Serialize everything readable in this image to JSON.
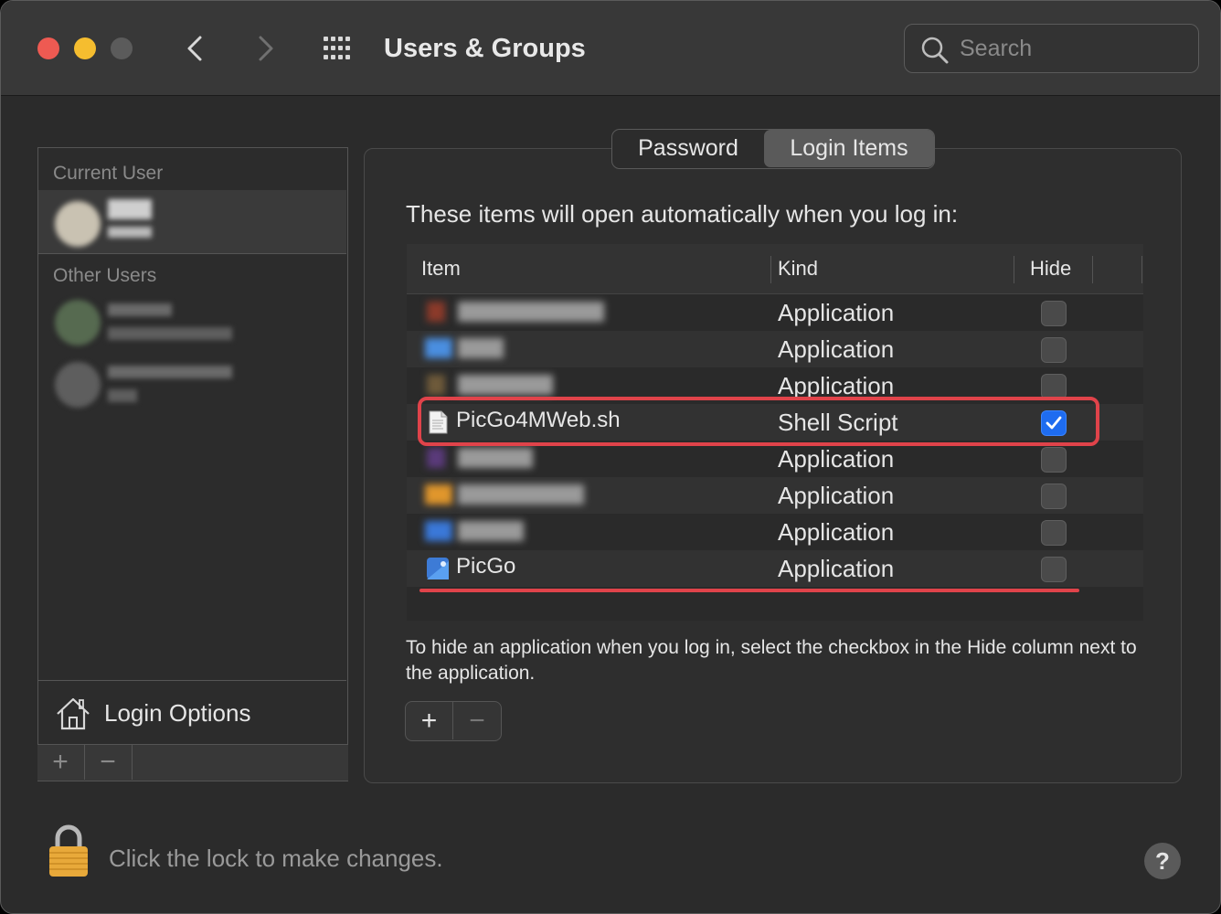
{
  "window": {
    "title": "Users & Groups"
  },
  "search": {
    "placeholder": "Search"
  },
  "users": {
    "current_label": "Current User",
    "other_label": "Other Users",
    "login_options": "Login Options",
    "add": "+",
    "remove": "−"
  },
  "tabs": [
    {
      "label": "Password",
      "selected": false
    },
    {
      "label": "Login Items",
      "selected": true
    }
  ],
  "login_items": {
    "intro": "These items will open automatically when you log in:",
    "columns": {
      "item": "Item",
      "kind": "Kind",
      "hide": "Hide"
    },
    "rows": [
      {
        "name": "",
        "kind": "Application",
        "hide": false,
        "redacted": true
      },
      {
        "name": "",
        "kind": "Application",
        "hide": false,
        "redacted": true
      },
      {
        "name": "",
        "kind": "Application",
        "hide": false,
        "redacted": true
      },
      {
        "name": "PicGo4MWeb.sh",
        "kind": "Shell Script",
        "hide": true,
        "redacted": false
      },
      {
        "name": "",
        "kind": "Application",
        "hide": false,
        "redacted": true
      },
      {
        "name": "",
        "kind": "Application",
        "hide": false,
        "redacted": true
      },
      {
        "name": "",
        "kind": "Application",
        "hide": false,
        "redacted": true
      },
      {
        "name": "PicGo",
        "kind": "Application",
        "hide": false,
        "redacted": false
      }
    ],
    "hint": "To hide an application when you log in, select the checkbox in the Hide column next to the application.",
    "add": "+",
    "remove": "−"
  },
  "footer": {
    "lock_text": "Click the lock to make changes.",
    "help": "?"
  },
  "colors": {
    "accent": "#1e6cf0",
    "highlight": "#e0434a"
  }
}
